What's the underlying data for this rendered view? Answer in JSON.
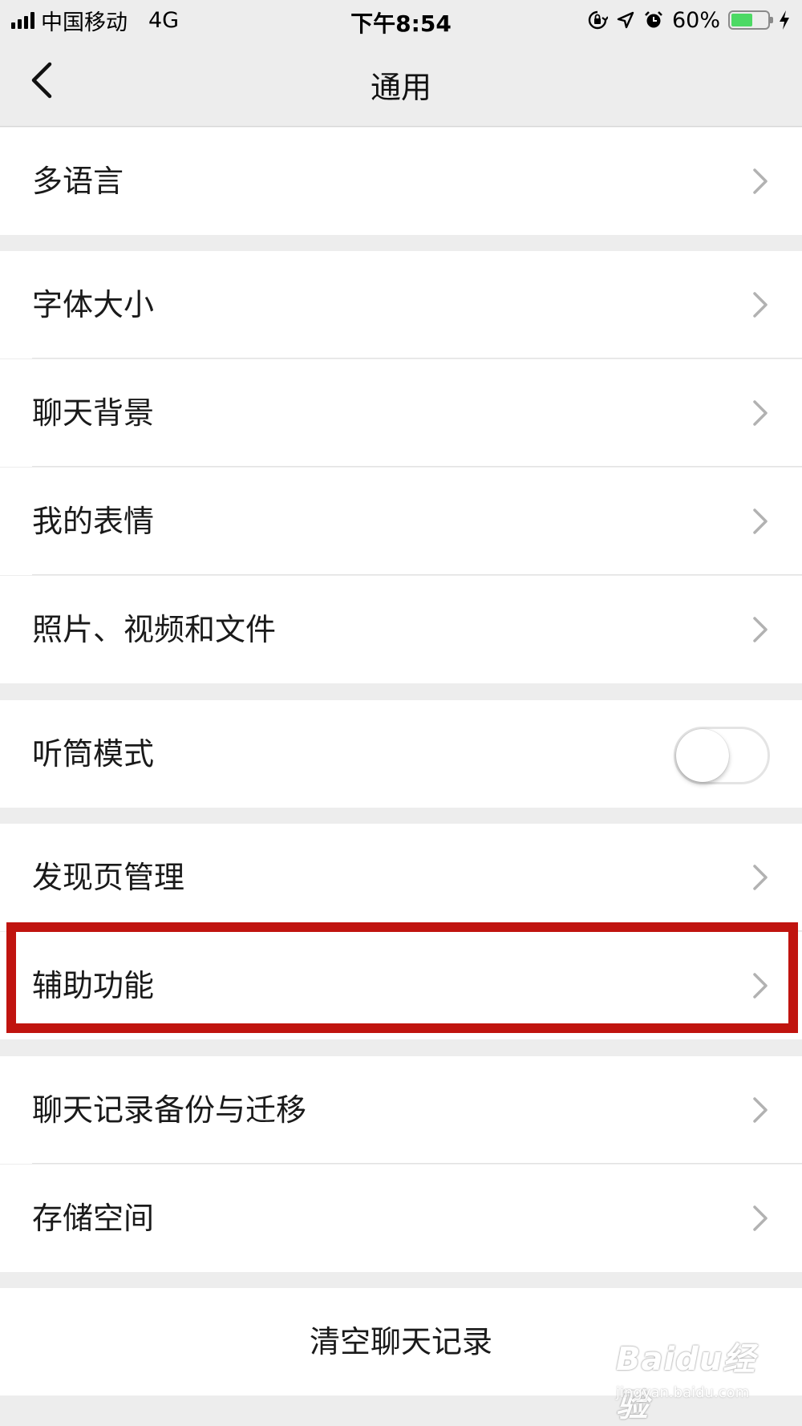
{
  "status_bar": {
    "carrier": "中国移动",
    "network": "4G",
    "time": "下午8:54",
    "battery_percent": "60%",
    "battery_level": 0.6,
    "battery_color": "#4cd964",
    "icons": [
      "signal-bars-icon",
      "orientation-lock-icon",
      "location-arrow-icon",
      "alarm-clock-icon",
      "battery-icon",
      "charging-bolt-icon"
    ]
  },
  "nav": {
    "title": "通用",
    "back_icon": "chevron-left-icon"
  },
  "groups": [
    {
      "items": [
        "多语言"
      ]
    },
    {
      "items": [
        "字体大小",
        "聊天背景",
        "我的表情",
        "照片、视频和文件"
      ]
    },
    {
      "items": [
        "听筒模式"
      ],
      "toggle_on": false
    },
    {
      "items": [
        "发现页管理",
        "辅助功能"
      ],
      "highlighted": "辅助功能",
      "highlight_color": "#c0140f"
    },
    {
      "items": [
        "聊天记录备份与迁移",
        "存储空间"
      ]
    }
  ],
  "rows": {
    "multi_language": "多语言",
    "font_size": "字体大小",
    "chat_background": "聊天背景",
    "my_stickers": "我的表情",
    "photos_videos_files": "照片、视频和文件",
    "earpiece_mode": "听筒模式",
    "discover_management": "发现页管理",
    "accessibility": "辅助功能",
    "chat_backup_migration": "聊天记录备份与迁移",
    "storage": "存储空间"
  },
  "toggles": {
    "earpiece_mode": false
  },
  "clear_button": "清空聊天记录",
  "watermark": {
    "logo": "Baidu经验",
    "sub": "jingyan.baidu.com"
  }
}
